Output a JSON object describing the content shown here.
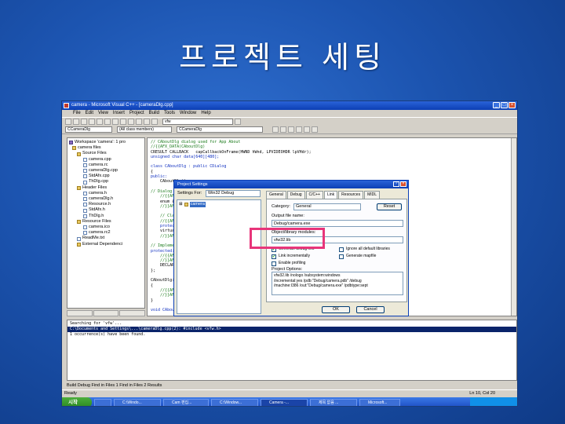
{
  "slide": {
    "title": "프로젝트 세팅"
  },
  "window": {
    "title": "camera - Microsoft Visual C++ - [cameraDlg.cpp]",
    "menu": [
      "File",
      "Edit",
      "View",
      "Insert",
      "Project",
      "Build",
      "Tools",
      "Window",
      "Help"
    ],
    "toolbar_combo": "vfw",
    "class_combo": "CCameraDlg",
    "members_combo": "(All class members)",
    "func_combo": "CCameraDlg"
  },
  "workspace": {
    "items": [
      "Workspace 'camera': 1 pro",
      "camera files",
      "Source Files",
      "camera.cpp",
      "camera.rc",
      "cameraDlg.cpp",
      "StdAfx.cpp",
      "ThDlg.cpp",
      "Header Files",
      "camera.h",
      "cameraDlg.h",
      "Resource.h",
      "StdAfx.h",
      "ThDlg.h",
      "Resource Files",
      "camera.ico",
      "camera.rc2",
      "ReadMe.txt",
      "External Dependenci"
    ]
  },
  "editor": {
    "lines": [
      "// CAboutDlg dialog used for App About",
      "//{{AFX_DATA(CAboutDlg)",
      "CRESULT CALLBACK   capCallbackOnFrame(HWND hWnd, LPVIDEOHDR lpVHdr);",
      "unsigned char data[640][480];",
      "",
      "class CAboutDlg : public CDialog",
      "{",
      "public:",
      "    CAboutDlg();",
      "",
      "// Dialog Data",
      "    //{{AFX_DATA(CAboutDlg)",
      "    enum { IDD = IDD_ABOUTBOX };",
      "    //}}AFX_DATA",
      "",
      "    // ClassWizard generated virtual function overrides",
      "    //{{AFX_VIRTUAL(CAboutDlg)",
      "    protected:",
      "    virtual void DoDataExchange(CDataExchange* pDX);",
      "    //}}AFX_VIRTUAL",
      "",
      "// Implementation",
      "protected:",
      "    //{{AFX_MSG(CAboutDlg)",
      "    //}}AFX_MSG",
      "    DECLARE_MESSAGE_MAP()",
      "};",
      "",
      "CAboutDlg::CAboutDlg() : CDialog(CAboutDlg::IDD)",
      "{",
      "    //{{AFX_DATA_INIT(CAboutDlg)",
      "    //}}AFX_DATA_INIT",
      "}",
      "",
      "void CAboutDlg::DoDataExchange(CDataExchange* pDX)"
    ]
  },
  "dialog": {
    "title": "Project Settings",
    "settings_for_label": "Settings For:",
    "settings_for_value": "Win32 Debug",
    "tree_item": "camera",
    "tabs": [
      "General",
      "Debug",
      "C/C++",
      "Link",
      "Resources",
      "MIDL"
    ],
    "category_label": "Category:",
    "category_value": "General",
    "reset_label": "Reset",
    "output_file_label": "Output file name:",
    "output_file_value": "Debug/camera.exe",
    "object_modules_label": "Object/library modules:",
    "object_modules_value": "vfw32.lib",
    "checks": [
      {
        "label": "Generate debug info",
        "checked": true
      },
      {
        "label": "Ignore all default libraries",
        "checked": false
      },
      {
        "label": "Link incrementally",
        "checked": true
      },
      {
        "label": "Generate mapfile",
        "checked": false
      },
      {
        "label": "Enable profiling",
        "checked": false
      }
    ],
    "project_options_label": "Project Options:",
    "project_options_text": "vfw32.lib /nologo /subsystem:windows\n/incremental:yes /pdb:\"Debug/camera.pdb\" /debug\n/machine:I386 /out:\"Debug/camera.exe\" /pdbtype:sept",
    "ok_label": "OK",
    "cancel_label": "Cancel"
  },
  "output": {
    "lines": [
      "Searching for 'vfw'...",
      "C:\\Documents and Settings\\...\\cameraDlg.cpp(2): #include <vfw.h>",
      "1 occurrence(s) have been found."
    ],
    "tabs": "Build  Debug  Find in Files 1  Find in Files 2  Results"
  },
  "status": {
    "left": "Ready",
    "position": "Ln 10, Col 20"
  },
  "taskbar": {
    "start_label": "시작",
    "tasks": [
      "C:\\Windo...",
      "Cam 편집...",
      "C:\\Window...",
      "Camera -...",
      "제목 없음 ...",
      "Microsoft..."
    ]
  }
}
